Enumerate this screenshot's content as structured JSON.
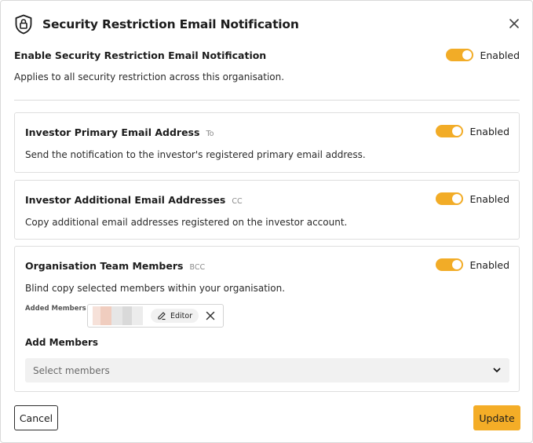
{
  "dialog": {
    "title": "Security Restriction Email Notification",
    "icon": "shield-lock-icon",
    "close_icon": "close-icon"
  },
  "master": {
    "label": "Enable Security Restriction Email Notification",
    "description": "Applies to all security restriction across this organisation.",
    "toggle_on": true,
    "toggle_text": "Enabled"
  },
  "recipients": [
    {
      "label": "Investor Primary Email Address",
      "tag": "To",
      "description": "Send the notification to the investor's registered primary email address.",
      "toggle_on": true,
      "toggle_text": "Enabled"
    },
    {
      "label": "Investor Additional Email Addresses",
      "tag": "CC",
      "description": "Copy additional email addresses registered on the investor account.",
      "toggle_on": true,
      "toggle_text": "Enabled"
    },
    {
      "label": "Organisation Team Members",
      "tag": "BCC",
      "description": "Blind copy selected members within your organisation.",
      "toggle_on": true,
      "toggle_text": "Enabled",
      "added_members_label": "Added Members",
      "members": [
        {
          "role": "Editor"
        }
      ],
      "add_members_label": "Add Members",
      "select_placeholder": "Select members"
    }
  ],
  "footer": {
    "cancel_label": "Cancel",
    "update_label": "Update"
  },
  "colors": {
    "accent": "#f4ad27",
    "toggle_on": "#f2ac27",
    "border": "#dedede"
  }
}
